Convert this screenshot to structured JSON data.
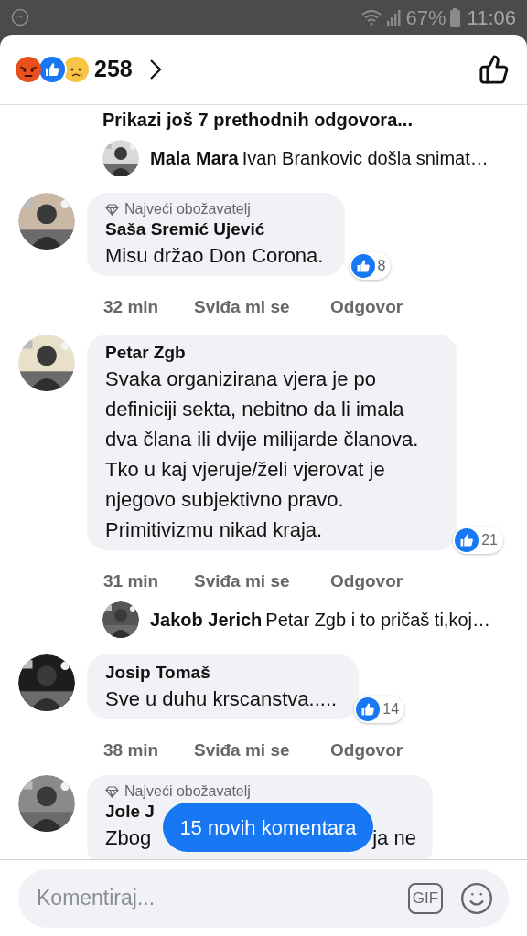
{
  "status_bar": {
    "battery": "67%",
    "time": "11:06"
  },
  "header": {
    "reaction_count": "258"
  },
  "thread": [
    {
      "kind": "more_replies",
      "text": "Prikazi još 7 prethodnih odgovora..."
    },
    {
      "kind": "reply",
      "name": "Mala Mara",
      "text": "Ivan Brankovic došla snimat…"
    },
    {
      "kind": "comment",
      "badge": "Najveći obožavatelj",
      "name": "Saša Sremić Ujević",
      "text": "Misu držao Don Corona.",
      "likes": "8",
      "time": "32 min",
      "like": "Sviđa mi se",
      "answer": "Odgovor"
    },
    {
      "kind": "comment",
      "name": "Petar Zgb",
      "text": "Svaka organizirana vjera je po definiciji sekta, nebitno da li imala dva člana ili dvije milijarde članova. Tko u kaj vjeruje/želi vjerovat je njegovo subjektivno pravo. Primitivizmu nikad kraja.",
      "likes": "21",
      "time": "31 min",
      "like": "Sviđa mi se",
      "answer": "Odgovor"
    },
    {
      "kind": "reply",
      "name": "Jakob Jerich",
      "text": "Petar Zgb i to pričaš ti,koj…"
    },
    {
      "kind": "comment",
      "name": "Josip Tomaš",
      "text": "Sve u duhu krscanstva.....",
      "likes": "14",
      "time": "38 min",
      "like": "Sviđa mi se",
      "answer": "Odgovor"
    },
    {
      "kind": "partial_comment",
      "badge": "Najveći obožavatelj",
      "name": "Jole J",
      "text_parts": [
        "Zbog",
        "ja ne"
      ]
    }
  ],
  "new_comments_button": "15 novih komentara",
  "composer": {
    "placeholder": "Komentiraj...",
    "gif": "GIF"
  }
}
